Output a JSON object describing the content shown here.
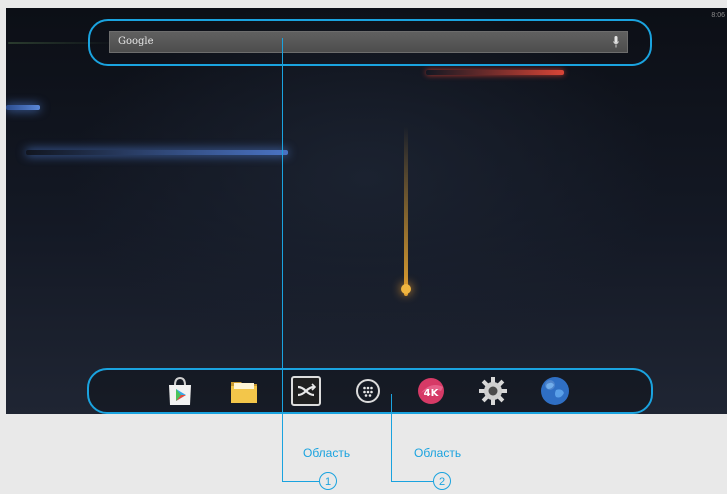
{
  "status_bar": {
    "time": "8:06"
  },
  "search": {
    "label": "Google",
    "mic_icon": "microphone-icon"
  },
  "dock": {
    "icons": [
      {
        "name": "play-store-icon"
      },
      {
        "name": "file-manager-icon"
      },
      {
        "name": "media-player-icon"
      },
      {
        "name": "app-drawer-icon"
      },
      {
        "name": "4k-player-icon"
      },
      {
        "name": "settings-icon"
      },
      {
        "name": "browser-globe-icon"
      }
    ]
  },
  "callouts": [
    {
      "label": "Область",
      "number": "1"
    },
    {
      "label": "Область",
      "number": "2"
    }
  ],
  "colors": {
    "accent": "#1aa3df",
    "page_bg": "#e9e9e9"
  }
}
